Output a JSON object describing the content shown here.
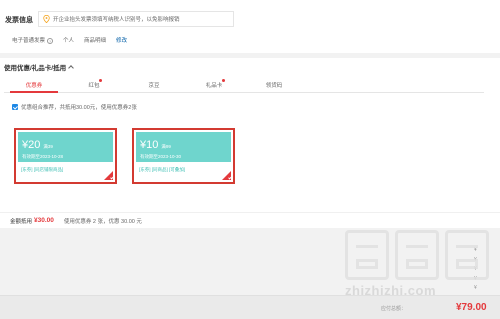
{
  "invoice": {
    "title": "发票信息",
    "notice": "开企业抬头发票须填写纳税人识别号，以免影响报销",
    "type": "电子普通发票",
    "holder": "个人",
    "content": "商品明细",
    "edit_label": "修改"
  },
  "coupon_section": {
    "title": "使用优惠/礼品卡/抵用",
    "tabs": [
      {
        "label": "优惠券",
        "active": true
      },
      {
        "label": "红包",
        "dot": true
      },
      {
        "label": "京豆",
        "dot": false
      },
      {
        "label": "礼品卡",
        "dot": true
      },
      {
        "label": "领货码",
        "dot": false
      }
    ],
    "combo_text": "优惠组合推荐，共抵用30.00元，使用优惠券2张",
    "coupons": [
      {
        "amount": "¥20",
        "condition": "满39",
        "valid": "有效期至2023-10-28",
        "tags": "[东券] [同店铺限商品]"
      },
      {
        "amount": "¥10",
        "condition": "满99",
        "valid": "有效期至2023-10-30",
        "tags": "[东券] [同商品] [可叠加]"
      }
    ],
    "summary_label": "金额抵用",
    "summary_amount": "¥30.00",
    "summary_desc": "使用优惠券 2 张，优惠 30.00 元"
  },
  "right_column": [
    "¥",
    "¥",
    "¥",
    "¥",
    "¥",
    "¥"
  ],
  "watermark": {
    "url": "zhizhizhi.com"
  },
  "footer": {
    "label": "应付总额：",
    "amount": "¥79.00"
  },
  "colors": {
    "accent": "#e4393c",
    "coupon": "#6fd5cd",
    "coupon_border": "#d33a31",
    "link": "#005ea7"
  }
}
